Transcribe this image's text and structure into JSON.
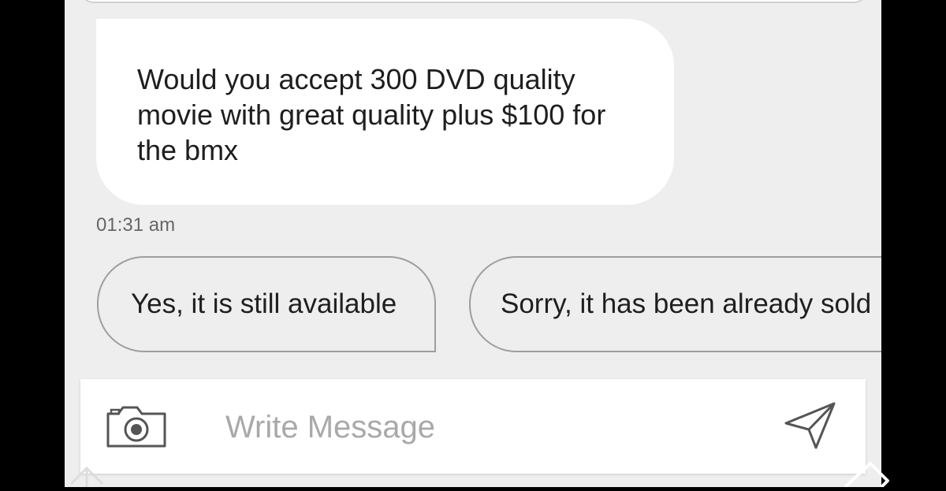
{
  "message": {
    "text": "Would you accept 300 DVD quality movie with great quality plus $100 for the bmx",
    "timestamp": "01:31 am"
  },
  "quick_replies": [
    {
      "label": "Yes, it is still available"
    },
    {
      "label": "Sorry, it has been already sold"
    }
  ],
  "composer": {
    "placeholder": "Write Message",
    "camera_icon": "camera-icon",
    "send_icon": "send-icon"
  },
  "colors": {
    "chat_background": "#eeeeee",
    "bubble_background": "#ffffff",
    "text": "#1e1e1e",
    "placeholder": "#a9a9a9",
    "border": "#9e9e9e"
  }
}
